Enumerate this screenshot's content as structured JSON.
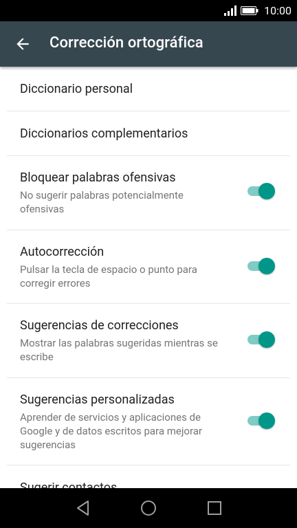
{
  "status": {
    "time": "10:00"
  },
  "toolbar": {
    "title": "Corrección ortográfica"
  },
  "items": [
    {
      "title": "Diccionario personal"
    },
    {
      "title": "Diccionarios complementarios"
    },
    {
      "title": "Bloquear palabras ofensivas",
      "subtitle": "No sugerir palabras potencialmente ofensivas",
      "on": true
    },
    {
      "title": "Autocorrección",
      "subtitle": "Pulsar la tecla de espacio o punto para corregir errores",
      "on": true
    },
    {
      "title": "Sugerencias de correcciones",
      "subtitle": "Mostrar las palabras sugeridas mientras se escribe",
      "on": true
    },
    {
      "title": "Sugerencias personalizadas",
      "subtitle": "Aprender de servicios y aplicaciones de Google y de datos escritos para mejorar sugerencias",
      "on": true
    },
    {
      "title": "Sugerir contactos"
    }
  ],
  "colors": {
    "toolbar": "#37474f",
    "accent": "#009688",
    "track": "#80cbc4"
  }
}
